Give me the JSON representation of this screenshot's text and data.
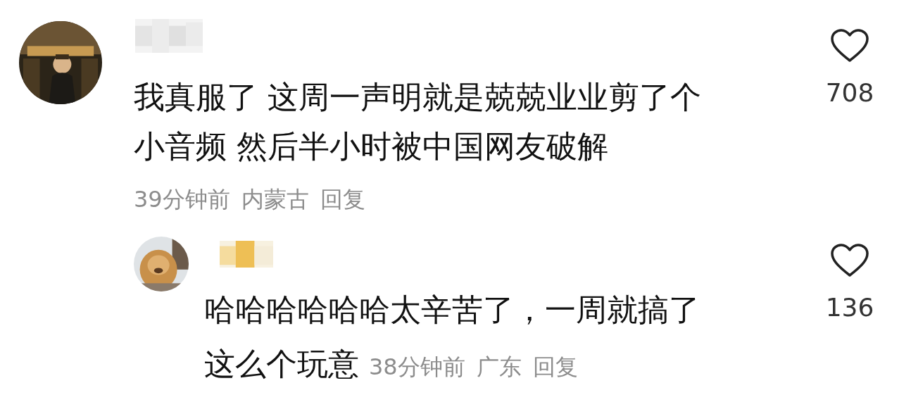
{
  "comments": [
    {
      "kind": "comment",
      "lines": [
        "我真服了 这周一声明就是兢兢业业剪了个",
        "小音频 然后半小时被中国网友破解"
      ],
      "time": "39分钟前",
      "location": "内蒙古",
      "reply_label": "回复",
      "likes": "708"
    },
    {
      "kind": "reply",
      "lines": [
        "哈哈哈哈哈哈太辛苦了，一周就搞了",
        "这么个玩意"
      ],
      "time": "38分钟前",
      "location": "广东",
      "reply_label": "回复",
      "likes": "136"
    }
  ]
}
